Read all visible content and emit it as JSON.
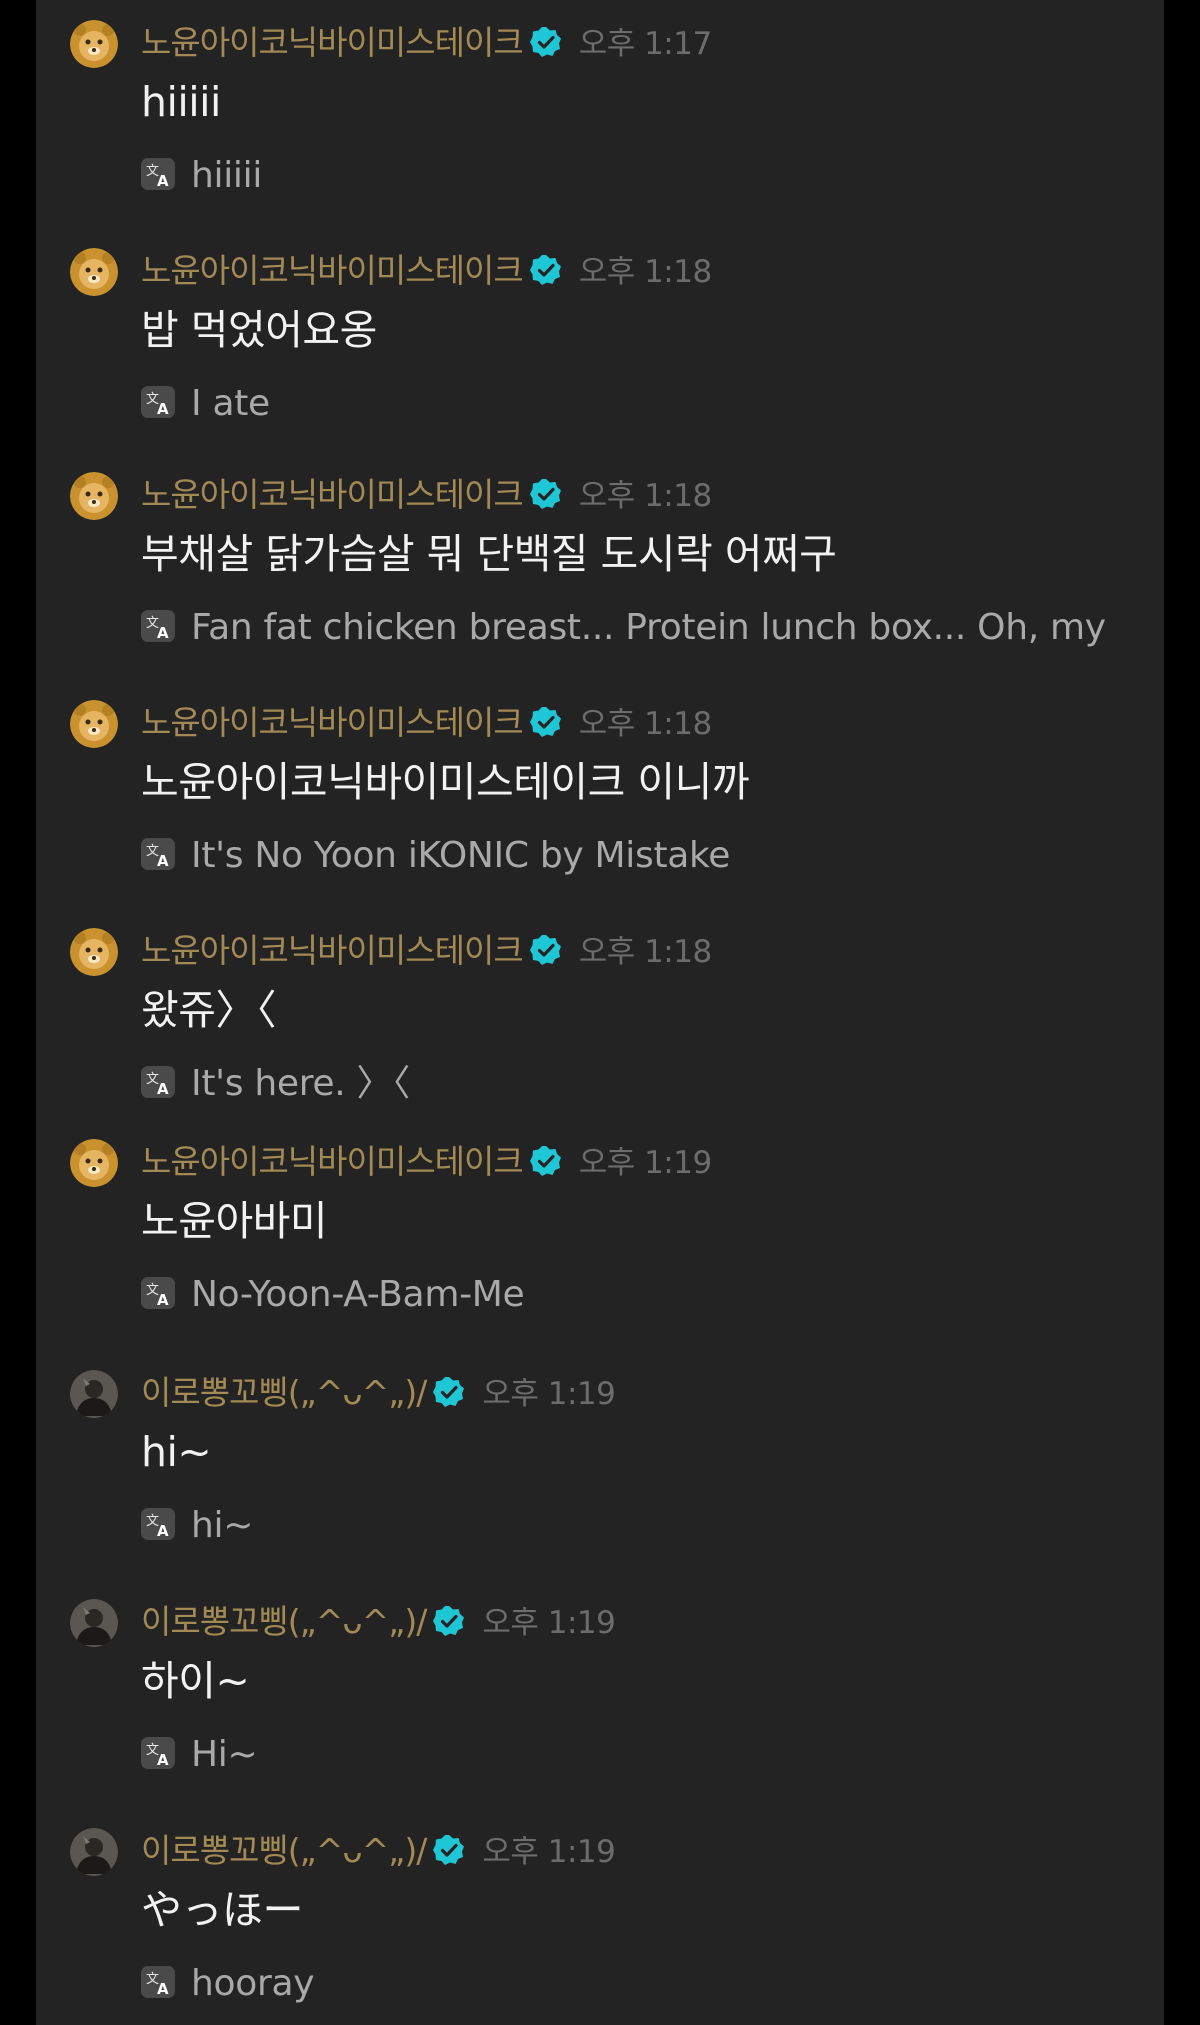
{
  "colors": {
    "background": "#232323",
    "outer": "#000000",
    "name": "#a38a54",
    "time": "#6c6c6c",
    "text": "#f2f2f2",
    "translation": "#a9a9a9",
    "verified": "#1fc6d6"
  },
  "icons": {
    "verified": "verified-badge-icon",
    "translate": "translate-icon",
    "avatar_user1": "bear-avatar",
    "avatar_user2": "dark-photo-avatar"
  },
  "messages": [
    {
      "name": "노윤아이코닉바이미스테이크",
      "time": "오후 1:17",
      "text": "hiiiii",
      "translation": "hiiiii"
    },
    {
      "name": "노윤아이코닉바이미스테이크",
      "time": "오후 1:18",
      "text": "밥 먹었어요옹",
      "translation": "I ate"
    },
    {
      "name": "노윤아이코닉바이미스테이크",
      "time": "오후 1:18",
      "text": "부채살 닭가슴살 뭐 단백질 도시락 어쩌구",
      "translation": "Fan fat chicken breast... Protein lunch box... Oh, my"
    },
    {
      "name": "노윤아이코닉바이미스테이크",
      "time": "오후 1:18",
      "text": "노윤아이코닉바이미스테이크 이니까",
      "translation": "It's No Yoon iKONIC by Mistake"
    },
    {
      "name": "노윤아이코닉바이미스테이크",
      "time": "오후 1:18",
      "text": "왔쥬〉〈",
      "translation": "It's here. 〉〈"
    },
    {
      "name": "노윤아이코닉바이미스테이크",
      "time": "오후 1:19",
      "text": "노윤아바미",
      "translation": "No-Yoon-A-Bam-Me"
    },
    {
      "name": "이로뽕꼬삥(„^ᴗ^„)/",
      "time": "오후 1:19",
      "text": "hi~",
      "translation": "hi~"
    },
    {
      "name": "이로뽕꼬삥(„^ᴗ^„)/",
      "time": "오후 1:19",
      "text": "하이~",
      "translation": "Hi~"
    },
    {
      "name": "이로뽕꼬삥(„^ᴗ^„)/",
      "time": "오후 1:19",
      "text": "やっほー",
      "translation": "hooray"
    }
  ]
}
